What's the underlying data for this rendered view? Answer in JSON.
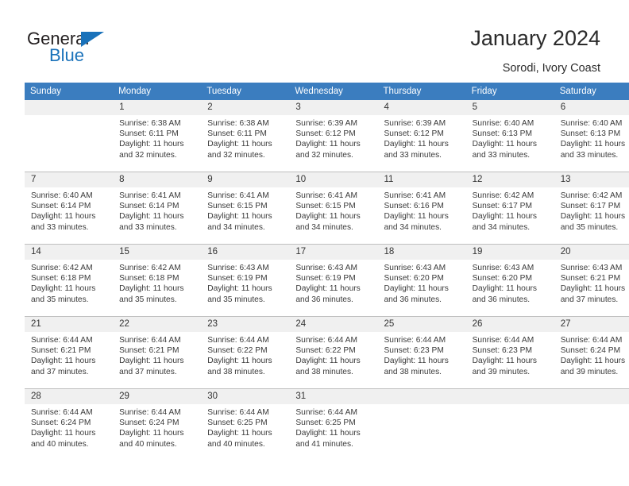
{
  "brand": {
    "name_top": "General",
    "name_bottom": "Blue",
    "accent_color": "#1a72ba",
    "triangle_icon": "brand-triangle-icon"
  },
  "header": {
    "title": "January 2024",
    "subtitle": "Sorodi, Ivory Coast"
  },
  "calendar": {
    "header_bg": "#3b7dbf",
    "daynum_bg": "#f0f0f0",
    "weekday_headers": [
      "Sunday",
      "Monday",
      "Tuesday",
      "Wednesday",
      "Thursday",
      "Friday",
      "Saturday"
    ],
    "weeks": [
      [
        {
          "day": "",
          "blank": true,
          "sunrise": "",
          "sunset": "",
          "daylight_line1": "",
          "daylight_line2": ""
        },
        {
          "day": "1",
          "sunrise": "Sunrise: 6:38 AM",
          "sunset": "Sunset: 6:11 PM",
          "daylight_line1": "Daylight: 11 hours",
          "daylight_line2": "and 32 minutes."
        },
        {
          "day": "2",
          "sunrise": "Sunrise: 6:38 AM",
          "sunset": "Sunset: 6:11 PM",
          "daylight_line1": "Daylight: 11 hours",
          "daylight_line2": "and 32 minutes."
        },
        {
          "day": "3",
          "sunrise": "Sunrise: 6:39 AM",
          "sunset": "Sunset: 6:12 PM",
          "daylight_line1": "Daylight: 11 hours",
          "daylight_line2": "and 32 minutes."
        },
        {
          "day": "4",
          "sunrise": "Sunrise: 6:39 AM",
          "sunset": "Sunset: 6:12 PM",
          "daylight_line1": "Daylight: 11 hours",
          "daylight_line2": "and 33 minutes."
        },
        {
          "day": "5",
          "sunrise": "Sunrise: 6:40 AM",
          "sunset": "Sunset: 6:13 PM",
          "daylight_line1": "Daylight: 11 hours",
          "daylight_line2": "and 33 minutes."
        },
        {
          "day": "6",
          "sunrise": "Sunrise: 6:40 AM",
          "sunset": "Sunset: 6:13 PM",
          "daylight_line1": "Daylight: 11 hours",
          "daylight_line2": "and 33 minutes."
        }
      ],
      [
        {
          "day": "7",
          "sunrise": "Sunrise: 6:40 AM",
          "sunset": "Sunset: 6:14 PM",
          "daylight_line1": "Daylight: 11 hours",
          "daylight_line2": "and 33 minutes."
        },
        {
          "day": "8",
          "sunrise": "Sunrise: 6:41 AM",
          "sunset": "Sunset: 6:14 PM",
          "daylight_line1": "Daylight: 11 hours",
          "daylight_line2": "and 33 minutes."
        },
        {
          "day": "9",
          "sunrise": "Sunrise: 6:41 AM",
          "sunset": "Sunset: 6:15 PM",
          "daylight_line1": "Daylight: 11 hours",
          "daylight_line2": "and 34 minutes."
        },
        {
          "day": "10",
          "sunrise": "Sunrise: 6:41 AM",
          "sunset": "Sunset: 6:15 PM",
          "daylight_line1": "Daylight: 11 hours",
          "daylight_line2": "and 34 minutes."
        },
        {
          "day": "11",
          "sunrise": "Sunrise: 6:41 AM",
          "sunset": "Sunset: 6:16 PM",
          "daylight_line1": "Daylight: 11 hours",
          "daylight_line2": "and 34 minutes."
        },
        {
          "day": "12",
          "sunrise": "Sunrise: 6:42 AM",
          "sunset": "Sunset: 6:17 PM",
          "daylight_line1": "Daylight: 11 hours",
          "daylight_line2": "and 34 minutes."
        },
        {
          "day": "13",
          "sunrise": "Sunrise: 6:42 AM",
          "sunset": "Sunset: 6:17 PM",
          "daylight_line1": "Daylight: 11 hours",
          "daylight_line2": "and 35 minutes."
        }
      ],
      [
        {
          "day": "14",
          "sunrise": "Sunrise: 6:42 AM",
          "sunset": "Sunset: 6:18 PM",
          "daylight_line1": "Daylight: 11 hours",
          "daylight_line2": "and 35 minutes."
        },
        {
          "day": "15",
          "sunrise": "Sunrise: 6:42 AM",
          "sunset": "Sunset: 6:18 PM",
          "daylight_line1": "Daylight: 11 hours",
          "daylight_line2": "and 35 minutes."
        },
        {
          "day": "16",
          "sunrise": "Sunrise: 6:43 AM",
          "sunset": "Sunset: 6:19 PM",
          "daylight_line1": "Daylight: 11 hours",
          "daylight_line2": "and 35 minutes."
        },
        {
          "day": "17",
          "sunrise": "Sunrise: 6:43 AM",
          "sunset": "Sunset: 6:19 PM",
          "daylight_line1": "Daylight: 11 hours",
          "daylight_line2": "and 36 minutes."
        },
        {
          "day": "18",
          "sunrise": "Sunrise: 6:43 AM",
          "sunset": "Sunset: 6:20 PM",
          "daylight_line1": "Daylight: 11 hours",
          "daylight_line2": "and 36 minutes."
        },
        {
          "day": "19",
          "sunrise": "Sunrise: 6:43 AM",
          "sunset": "Sunset: 6:20 PM",
          "daylight_line1": "Daylight: 11 hours",
          "daylight_line2": "and 36 minutes."
        },
        {
          "day": "20",
          "sunrise": "Sunrise: 6:43 AM",
          "sunset": "Sunset: 6:21 PM",
          "daylight_line1": "Daylight: 11 hours",
          "daylight_line2": "and 37 minutes."
        }
      ],
      [
        {
          "day": "21",
          "sunrise": "Sunrise: 6:44 AM",
          "sunset": "Sunset: 6:21 PM",
          "daylight_line1": "Daylight: 11 hours",
          "daylight_line2": "and 37 minutes."
        },
        {
          "day": "22",
          "sunrise": "Sunrise: 6:44 AM",
          "sunset": "Sunset: 6:21 PM",
          "daylight_line1": "Daylight: 11 hours",
          "daylight_line2": "and 37 minutes."
        },
        {
          "day": "23",
          "sunrise": "Sunrise: 6:44 AM",
          "sunset": "Sunset: 6:22 PM",
          "daylight_line1": "Daylight: 11 hours",
          "daylight_line2": "and 38 minutes."
        },
        {
          "day": "24",
          "sunrise": "Sunrise: 6:44 AM",
          "sunset": "Sunset: 6:22 PM",
          "daylight_line1": "Daylight: 11 hours",
          "daylight_line2": "and 38 minutes."
        },
        {
          "day": "25",
          "sunrise": "Sunrise: 6:44 AM",
          "sunset": "Sunset: 6:23 PM",
          "daylight_line1": "Daylight: 11 hours",
          "daylight_line2": "and 38 minutes."
        },
        {
          "day": "26",
          "sunrise": "Sunrise: 6:44 AM",
          "sunset": "Sunset: 6:23 PM",
          "daylight_line1": "Daylight: 11 hours",
          "daylight_line2": "and 39 minutes."
        },
        {
          "day": "27",
          "sunrise": "Sunrise: 6:44 AM",
          "sunset": "Sunset: 6:24 PM",
          "daylight_line1": "Daylight: 11 hours",
          "daylight_line2": "and 39 minutes."
        }
      ],
      [
        {
          "day": "28",
          "sunrise": "Sunrise: 6:44 AM",
          "sunset": "Sunset: 6:24 PM",
          "daylight_line1": "Daylight: 11 hours",
          "daylight_line2": "and 40 minutes."
        },
        {
          "day": "29",
          "sunrise": "Sunrise: 6:44 AM",
          "sunset": "Sunset: 6:24 PM",
          "daylight_line1": "Daylight: 11 hours",
          "daylight_line2": "and 40 minutes."
        },
        {
          "day": "30",
          "sunrise": "Sunrise: 6:44 AM",
          "sunset": "Sunset: 6:25 PM",
          "daylight_line1": "Daylight: 11 hours",
          "daylight_line2": "and 40 minutes."
        },
        {
          "day": "31",
          "sunrise": "Sunrise: 6:44 AM",
          "sunset": "Sunset: 6:25 PM",
          "daylight_line1": "Daylight: 11 hours",
          "daylight_line2": "and 41 minutes."
        },
        {
          "day": "",
          "blank": true,
          "sunrise": "",
          "sunset": "",
          "daylight_line1": "",
          "daylight_line2": ""
        },
        {
          "day": "",
          "blank": true,
          "sunrise": "",
          "sunset": "",
          "daylight_line1": "",
          "daylight_line2": ""
        },
        {
          "day": "",
          "blank": true,
          "sunrise": "",
          "sunset": "",
          "daylight_line1": "",
          "daylight_line2": ""
        }
      ]
    ]
  }
}
